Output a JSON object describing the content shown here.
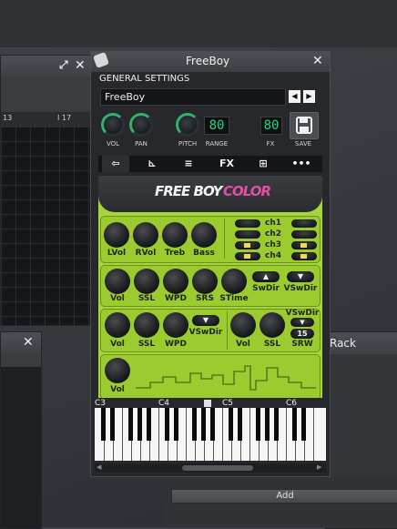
{
  "left_window": {
    "ruler": [
      "13",
      "I 17"
    ]
  },
  "rack_window": {
    "title": "Rack",
    "add_label": "Add"
  },
  "freeboy": {
    "title": "FreeBoy",
    "section_title": "GENERAL SETTINGS",
    "preset_name": "FreeBoy",
    "controls": {
      "vol": "VOL",
      "pan": "PAN",
      "pitch": "PITCH",
      "range": "RANGE",
      "fx": "FX",
      "save": "SAVE"
    },
    "range_value": "80",
    "fx_value": "80",
    "tabs": [
      "⇦",
      "⊾",
      "≡",
      "FX",
      "⊞",
      "•••"
    ],
    "logo": {
      "free_boy": "FREE BOY",
      "color": "COLOR"
    },
    "row1": [
      "LVol",
      "RVol",
      "Treb",
      "Bass"
    ],
    "channels": [
      "ch1",
      "ch2",
      "ch3",
      "ch4"
    ],
    "row2": [
      "Vol",
      "SSL",
      "WPD",
      "SRS",
      "STime",
      "SwDir",
      "VSwDir"
    ],
    "row3": [
      "Vol",
      "SSL",
      "WPD",
      "VSwDir",
      "Vol",
      "SSL",
      "VSwDir",
      "SRW"
    ],
    "srw_value": "15",
    "row4": [
      "Vol"
    ],
    "piano_notes": [
      "C3",
      "C4",
      "C5",
      "C6"
    ]
  },
  "colors": {
    "accent_green": "#2fb36a",
    "gameboy_green": "#a5d43c",
    "lcd_green": "#25d18a"
  }
}
